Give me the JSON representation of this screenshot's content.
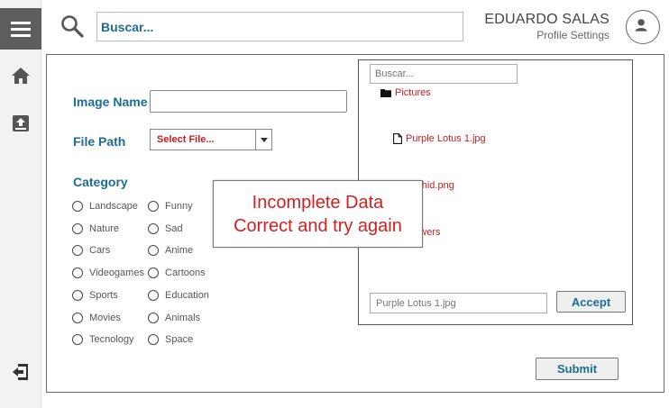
{
  "header": {
    "search_placeholder": "Buscar...",
    "user_name": "EDUARDO SALAS",
    "profile_link": "Profile Settings"
  },
  "sidebar": {
    "icons": [
      "menu-icon",
      "home-icon",
      "upload-box-icon",
      "logout-icon"
    ]
  },
  "form": {
    "image_name_label": "Image Name",
    "image_name_value": "",
    "file_path_label": "File Path",
    "file_path_select": "Select File...",
    "category_label": "Category",
    "categories_left": [
      "Landscape",
      "Nature",
      "Cars",
      "Videogames",
      "Sports",
      "Movies",
      "Tecnology"
    ],
    "categories_right": [
      "Funny",
      "Sad",
      "Anime",
      "Cartoons",
      "Education",
      "Animals",
      "Space"
    ],
    "submit_label": "Submit"
  },
  "file_browser": {
    "search_placeholder": "Buscar...",
    "items": [
      {
        "name": "Pictures",
        "icon": "folder-icon"
      },
      {
        "name": "Purple Lotus 1.jpg",
        "icon": "file-icon"
      },
      {
        "name": "Orchid.png",
        "icon": "file-icon"
      },
      {
        "name": "Flowers",
        "icon": "file-icon"
      }
    ],
    "selected_file_placeholder": "Purple Lotus 1.jpg",
    "accept_label": "Accept"
  },
  "error_dialog": {
    "line1": "Incomplete Data",
    "line2": "Correct and try again"
  },
  "colors": {
    "accent": "#1c6d92",
    "error": "#d22020",
    "file_text": "#c31e1e",
    "menu_bg": "#5d5d5d"
  }
}
